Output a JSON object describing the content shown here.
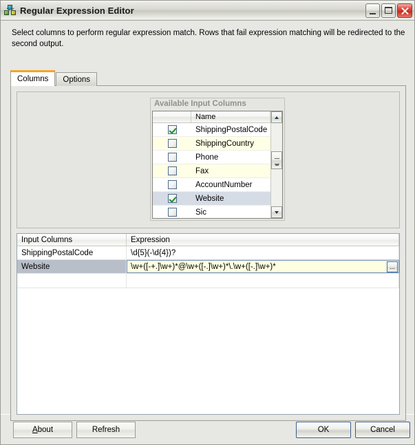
{
  "window": {
    "title": "Regular Expression Editor",
    "icon": "transform-node-icon",
    "caption_buttons": [
      {
        "name": "minimize",
        "label": "Minimize"
      },
      {
        "name": "restore",
        "label": "Restore"
      },
      {
        "name": "close",
        "label": "Close"
      }
    ]
  },
  "instructions": "Select columns to perform regular expression match. Rows that fail expression matching will be redirected to the second output.",
  "tabs": [
    {
      "label": "Columns",
      "active": true
    },
    {
      "label": "Options",
      "active": false
    }
  ],
  "available_columns": {
    "caption": "Available Input Columns",
    "headers": {
      "checkbox": "",
      "name": "Name"
    },
    "rows": [
      {
        "name": "ShippingPostalCode",
        "checked": true,
        "alt": false,
        "selected": false
      },
      {
        "name": "ShippingCountry",
        "checked": false,
        "alt": true,
        "selected": false
      },
      {
        "name": "Phone",
        "checked": false,
        "alt": false,
        "selected": false
      },
      {
        "name": "Fax",
        "checked": false,
        "alt": true,
        "selected": false
      },
      {
        "name": "AccountNumber",
        "checked": false,
        "alt": false,
        "selected": false
      },
      {
        "name": "Website",
        "checked": true,
        "alt": false,
        "selected": true
      },
      {
        "name": "Sic",
        "checked": false,
        "alt": false,
        "selected": false
      }
    ],
    "scrollbar": {
      "up": "scroll-up",
      "down": "scroll-down",
      "thumb": "scroll-thumb"
    }
  },
  "expression_grid": {
    "headers": {
      "input_columns": "Input Columns",
      "expression": "Expression"
    },
    "rows": [
      {
        "input_column": "ShippingPostalCode",
        "expression": "\\d{5}(-\\d{4})?",
        "selected": false,
        "has_ellipsis": false
      },
      {
        "input_column": "Website",
        "expression": "\\w+([-+.]\\w+)*@\\w+([-.]\\w+)*\\.\\w+([-.]\\w+)*",
        "selected": true,
        "has_ellipsis": true,
        "ellipsis_label": "..."
      }
    ]
  },
  "footer": {
    "about": {
      "accel": "A",
      "rest": "bout"
    },
    "refresh": "Refresh",
    "ok": "OK",
    "cancel": "Cancel"
  },
  "colors": {
    "accent_tab": "#f2a626",
    "selection": "#b9bfc9",
    "edit_background": "#ffffe1",
    "alt_row": "#ffffe6",
    "checkmark": "#1b8f2b",
    "close_button": "#c22f21"
  }
}
